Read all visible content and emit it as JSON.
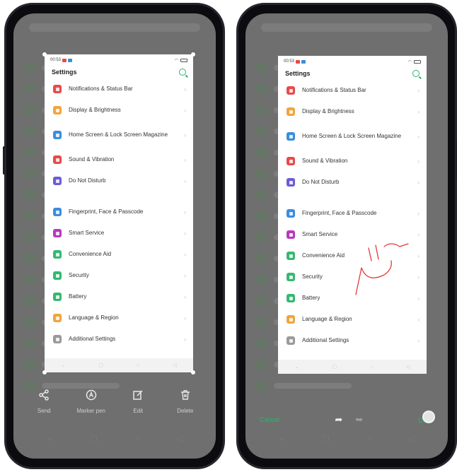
{
  "screenshot": {
    "status_time": "00:53",
    "title": "Settings",
    "items": [
      {
        "label": "Notifications & Status Bar",
        "color": "#e84a4a"
      },
      {
        "label": "Display & Brightness",
        "color": "#f1a53a"
      },
      {
        "label": "Home Screen & Lock Screen Magazine",
        "color": "#3a8de0"
      },
      {
        "label": "Sound & Vibration",
        "color": "#e84a4a"
      },
      {
        "label": "Do Not Disturb",
        "color": "#6b5bd6"
      },
      {
        "label": "Fingerprint, Face & Passcode",
        "color": "#3a8de0"
      },
      {
        "label": "Smart Service",
        "color": "#b83ab8"
      },
      {
        "label": "Convenience Aid",
        "color": "#36b872"
      },
      {
        "label": "Security",
        "color": "#36b872"
      },
      {
        "label": "Battery",
        "color": "#36b872"
      },
      {
        "label": "Language & Region",
        "color": "#f1a53a"
      },
      {
        "label": "Additional Settings",
        "color": "#9a9a9a"
      }
    ]
  },
  "left_toolbar": {
    "send": "Send",
    "marker": "Marker pen",
    "edit": "Edit",
    "delete": "Delete"
  },
  "right_toolbar": {
    "cancel": "Cancel",
    "done": "Done"
  },
  "colors": {
    "accent": "#2fb36e",
    "annotation": "#e03a3a"
  },
  "icons": [
    "share-icon",
    "marker-pen-icon",
    "edit-icon",
    "trash-icon",
    "undo-icon",
    "redo-icon",
    "search-icon",
    "chevron-right-icon"
  ]
}
